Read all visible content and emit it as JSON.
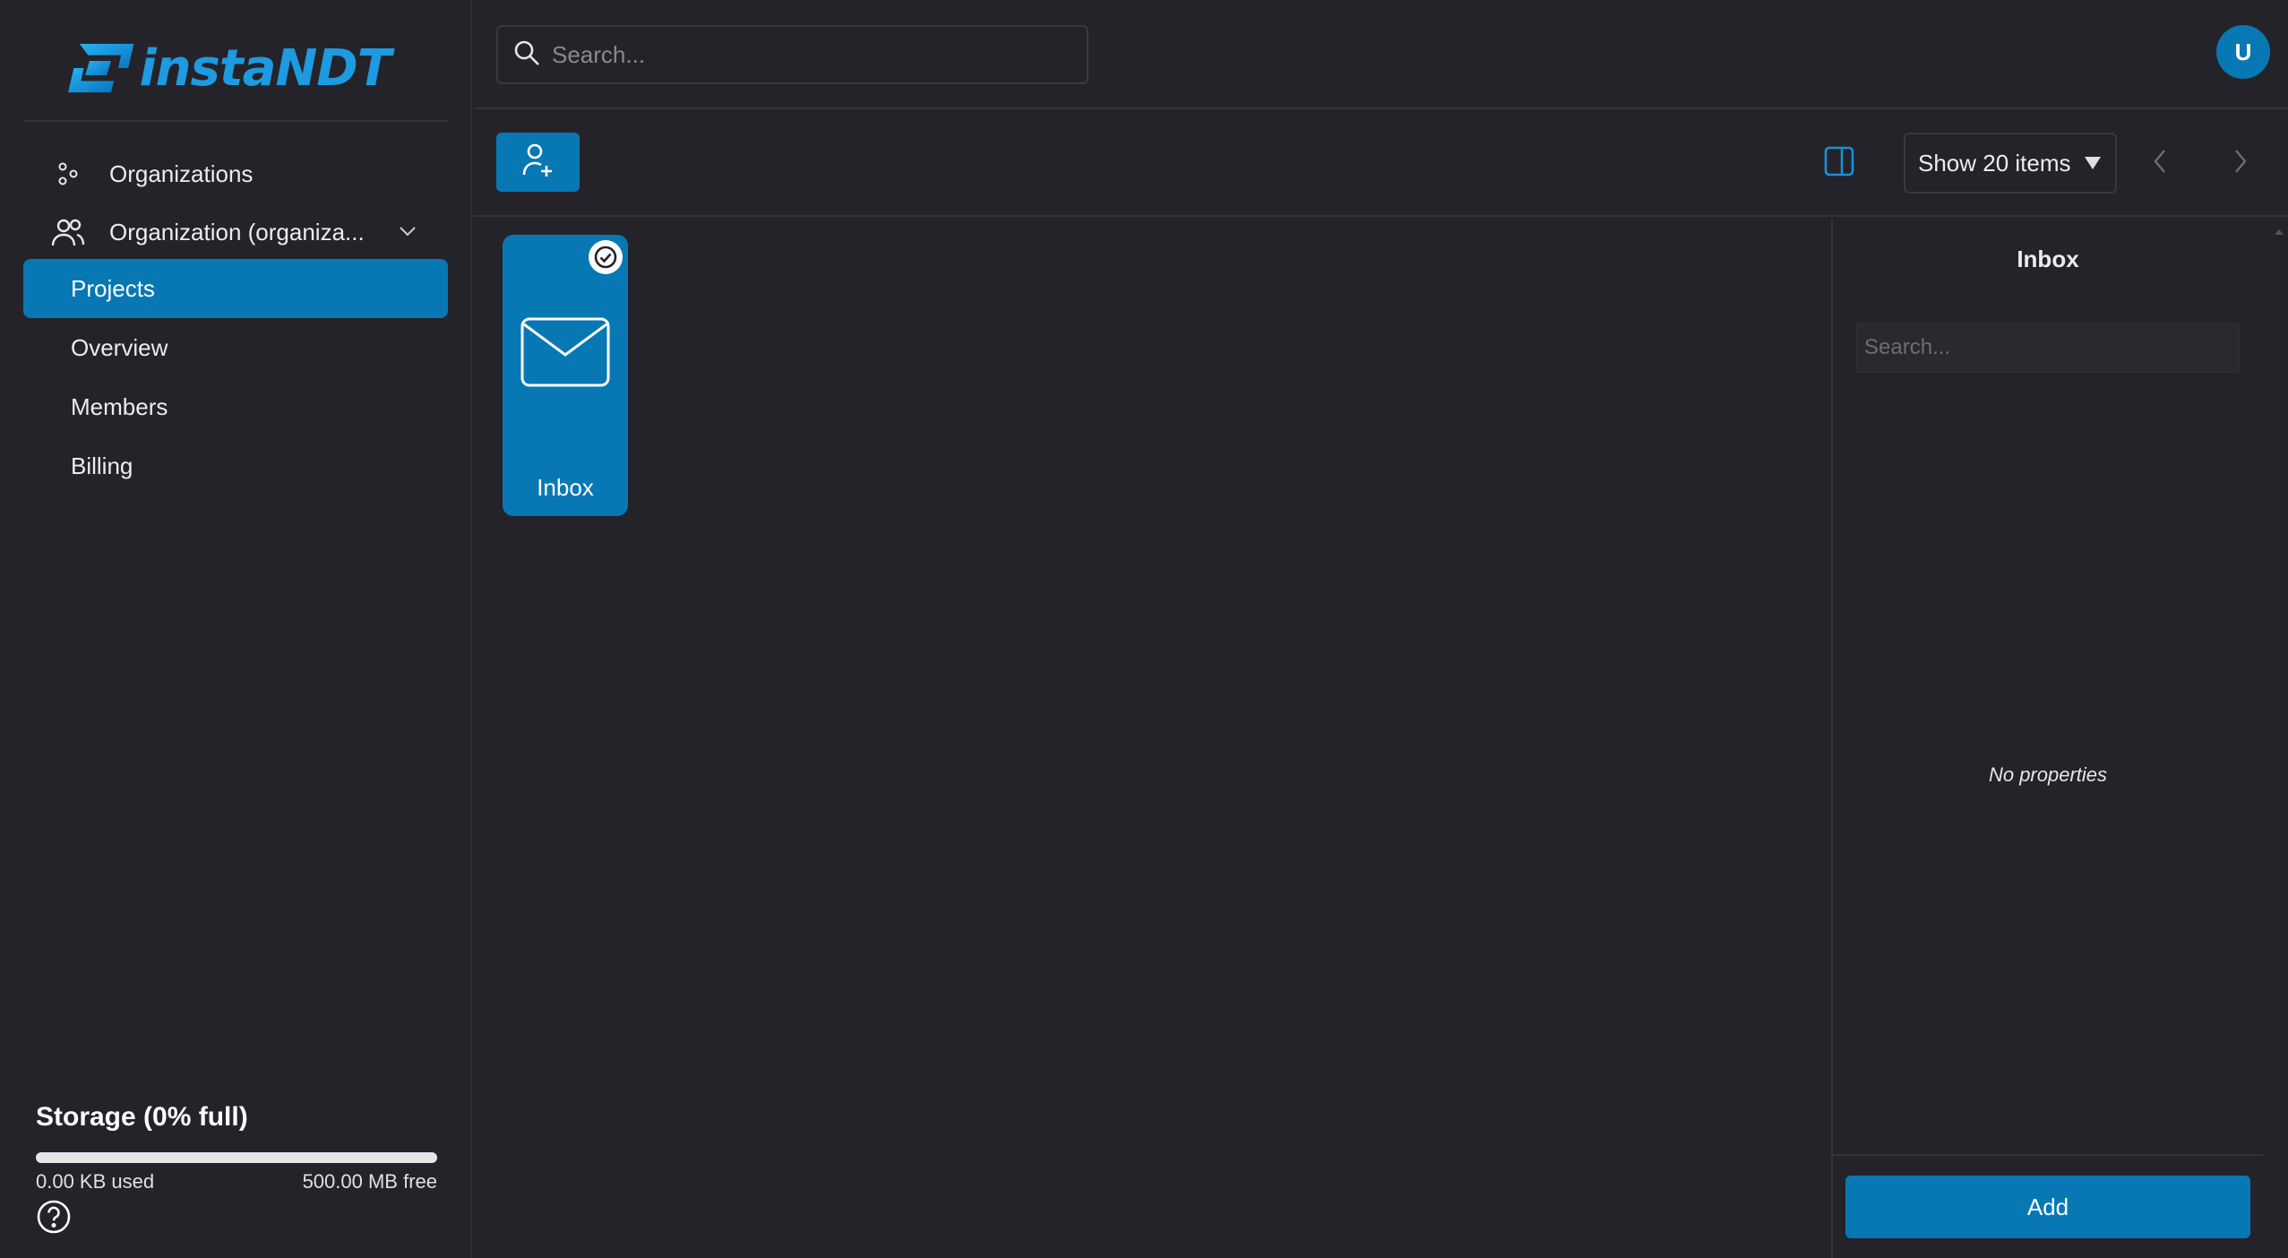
{
  "app": {
    "brand_text": "instaNDT",
    "brand_color": "#1d9ae0",
    "accent_color": "#0878b4",
    "background_color": "#242329"
  },
  "sidebar": {
    "items": [
      {
        "label": "Organizations",
        "icon": "organizations-icon"
      },
      {
        "label": "Organization (organiza...",
        "icon": "users-icon"
      },
      {
        "label": "Projects",
        "active": true
      },
      {
        "label": "Overview"
      },
      {
        "label": "Members"
      },
      {
        "label": "Billing"
      }
    ],
    "storage": {
      "title": "Storage (0% full)",
      "used": "0.00 KB used",
      "free": "500.00 MB free",
      "percent_full": 0
    }
  },
  "topbar": {
    "search_placeholder": "Search...",
    "avatar_initial": "U"
  },
  "toolbar": {
    "page_size_label": "Show 20 items"
  },
  "content": {
    "folders": [
      {
        "label": "Inbox",
        "icon": "mail-icon",
        "selected": true
      }
    ]
  },
  "properties": {
    "title": "Inbox",
    "search_placeholder": "Search...",
    "empty_text": "No properties",
    "add_label": "Add"
  }
}
